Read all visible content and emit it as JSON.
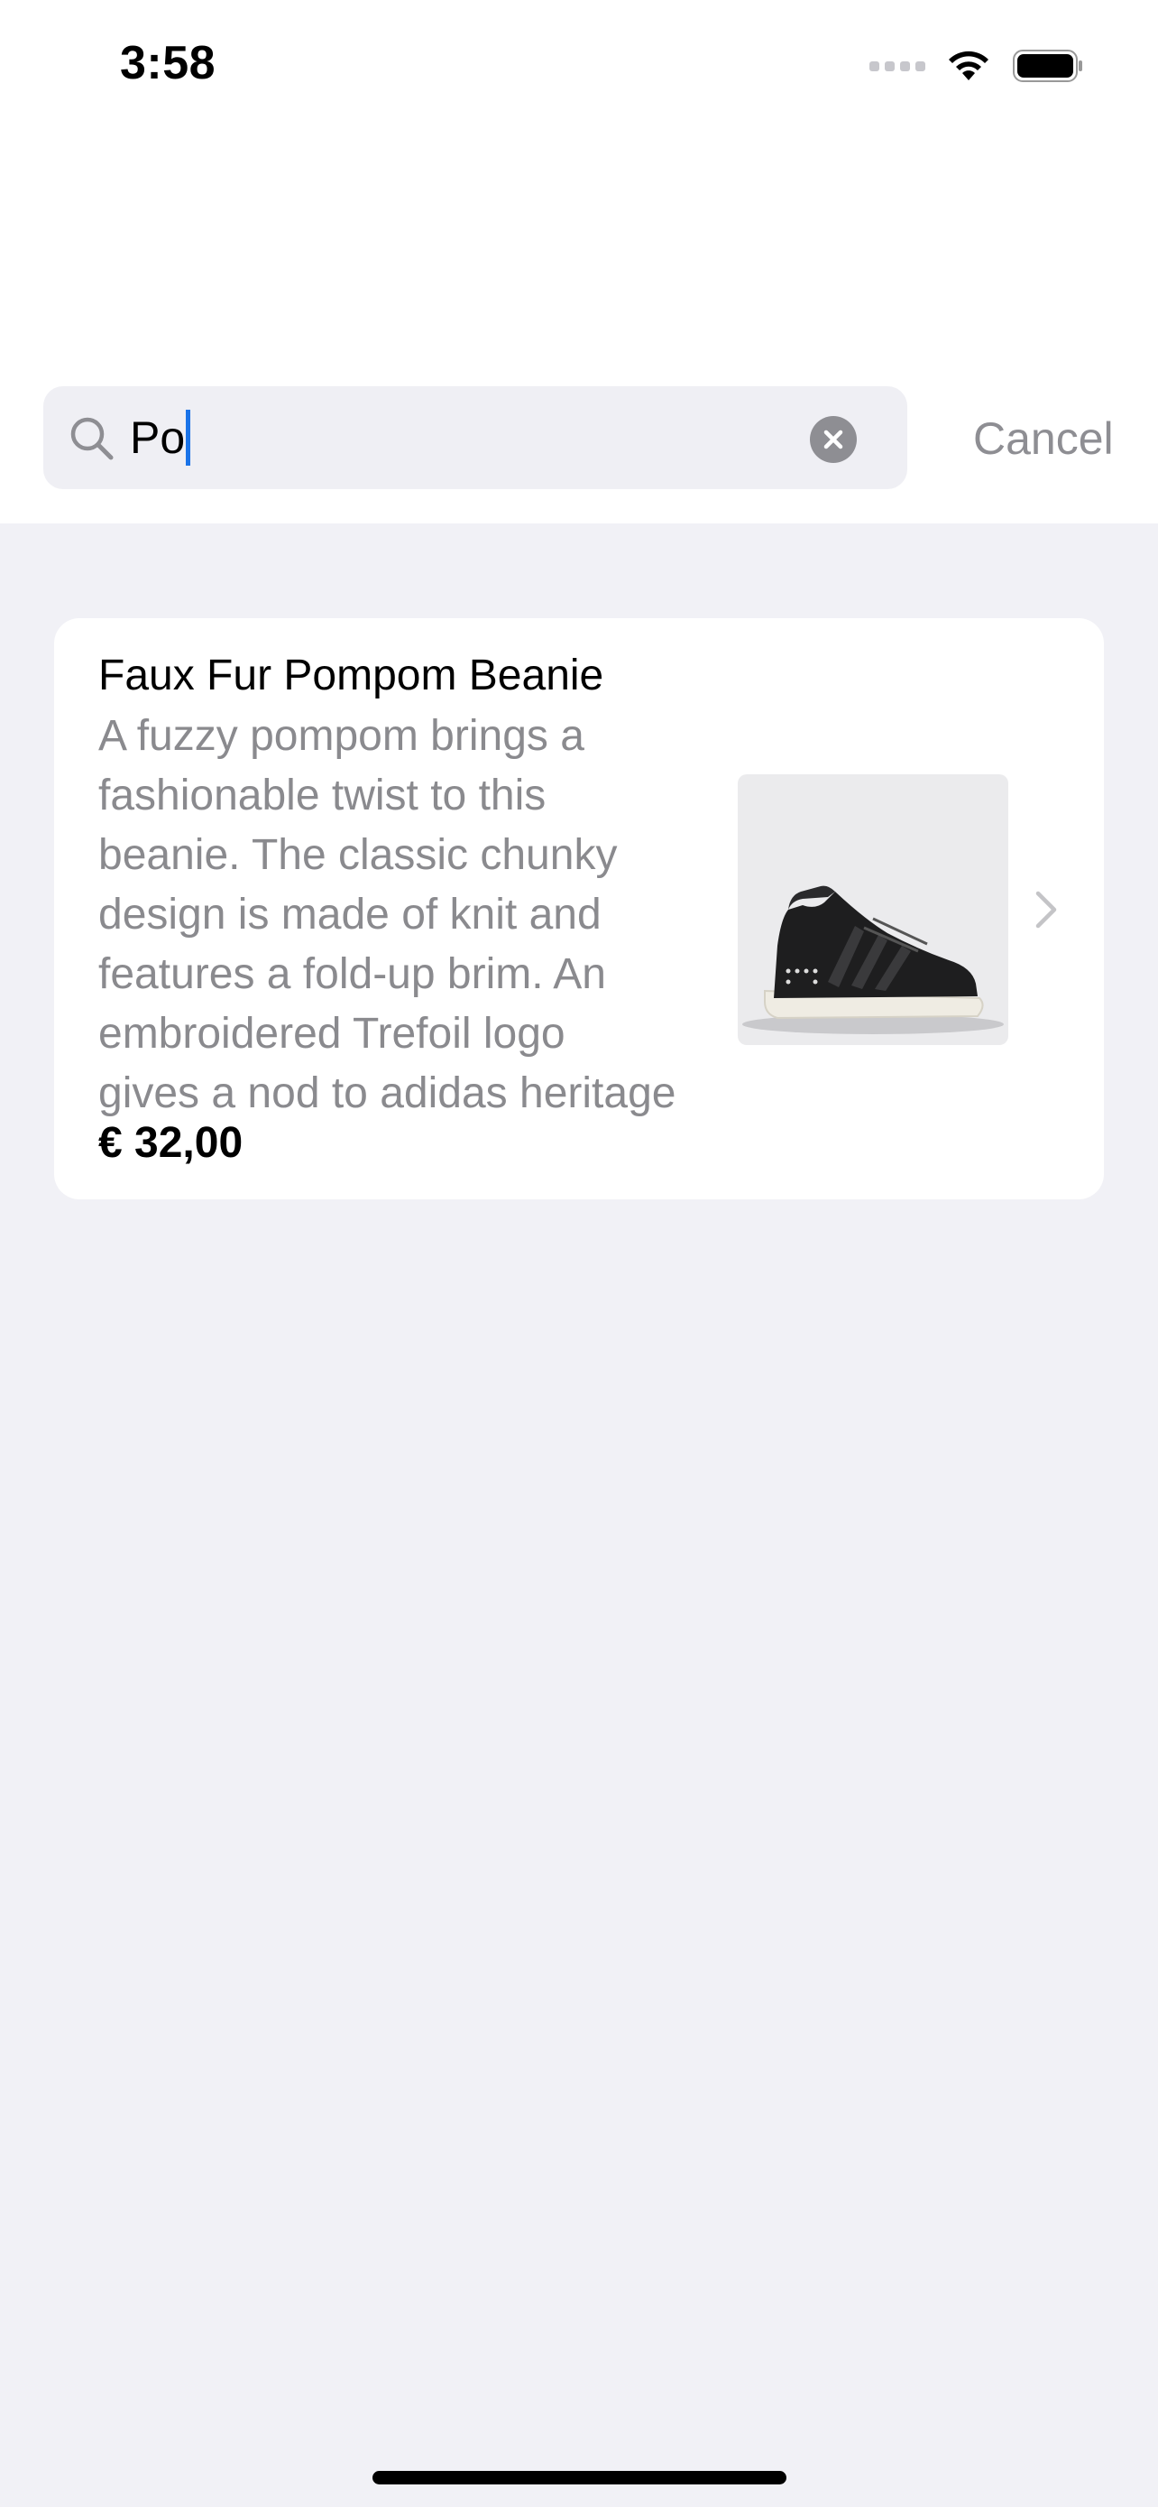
{
  "status_bar": {
    "time": "3:58",
    "icons": [
      "signal-icon",
      "wifi-icon",
      "battery-icon"
    ]
  },
  "search": {
    "query": "Po",
    "cancel_label": "Cancel",
    "icons": [
      "search-icon",
      "clear-icon"
    ]
  },
  "results": [
    {
      "title": "Faux Fur Pompom Beanie",
      "description": "A fuzzy pompom brings a\nfashionable twist to this\nbeanie. The classic chunky\ndesign is made of knit and\nfeatures a fold-up brim. An\nembroidered Trefoil logo\ngives a nod to adidas heritage",
      "price": "€ 32,00",
      "image": "black-high-top-sneaker-image",
      "icon": "chevron-right-icon"
    }
  ],
  "colors": {
    "background": "#f1f1f6",
    "card": "#ffffff",
    "search_field": "#efeff4",
    "caret": "#1a73e8",
    "secondary_text": "#8a8a8e"
  }
}
